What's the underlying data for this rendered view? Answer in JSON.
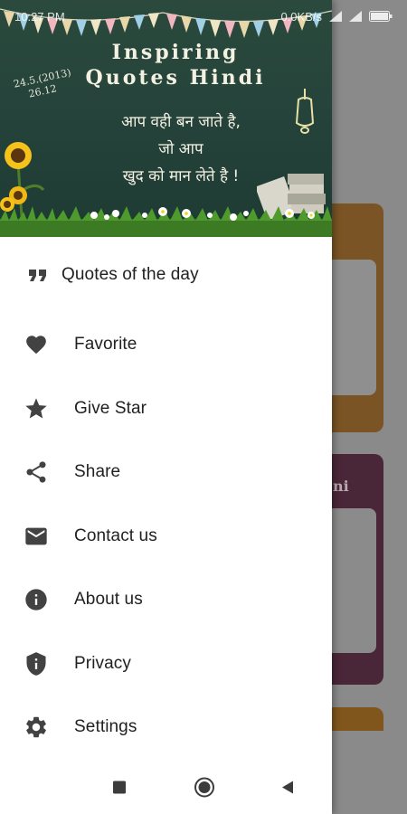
{
  "status_bar": {
    "time": "10:27 PM",
    "net": "0.0KB/s"
  },
  "header": {
    "title_line1": "Inspiring",
    "title_line2": "Quotes Hindi",
    "chalk_date_line1": "24.5.(2013)",
    "chalk_date_line2": "26.12",
    "quote_line1": "आप वही बन जाते है,",
    "quote_line2": "जो आप",
    "quote_line3": "खुद को मान लेते है !"
  },
  "menu": {
    "items": [
      {
        "label": "Quotes of the day",
        "icon": "quote-icon"
      },
      {
        "label": "Favorite",
        "icon": "heart-icon"
      },
      {
        "label": "Give Star",
        "icon": "star-icon"
      },
      {
        "label": "Share",
        "icon": "share-icon"
      },
      {
        "label": "Contact us",
        "icon": "mail-icon"
      },
      {
        "label": "About us",
        "icon": "info-icon"
      },
      {
        "label": "Privacy",
        "icon": "shield-icon"
      },
      {
        "label": "Settings",
        "icon": "gear-icon"
      }
    ]
  },
  "background": {
    "card_fragment": "ni"
  },
  "navbar": {
    "buttons": [
      "recents-button",
      "home-button",
      "back-button"
    ]
  },
  "colors": {
    "icon": "#424242",
    "text": "#212121",
    "header_bg": "#24423a",
    "scrim": "#6f6f6f"
  }
}
